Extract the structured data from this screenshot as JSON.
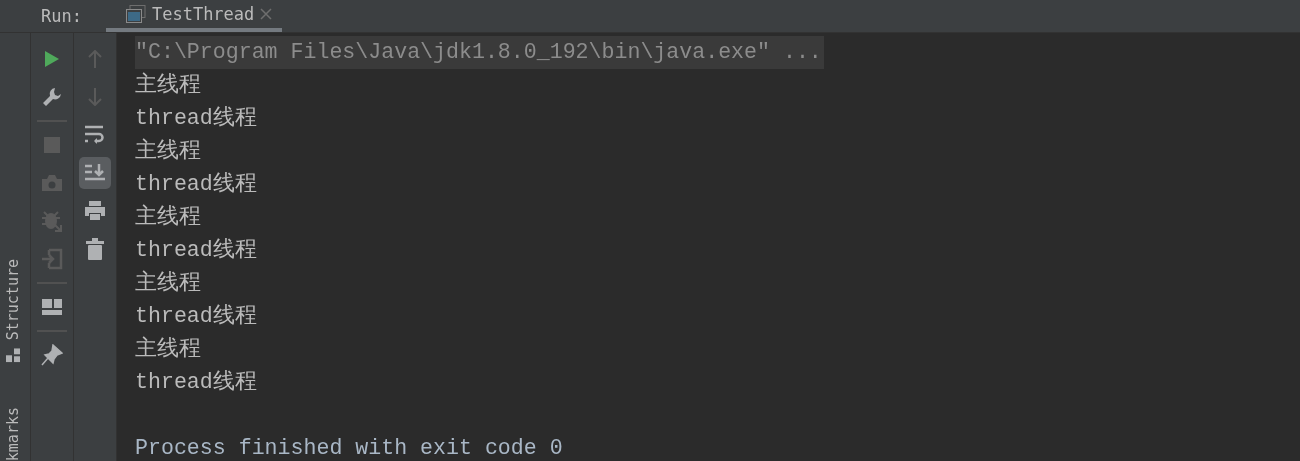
{
  "header": {
    "label": "Run:",
    "tabs": [
      {
        "title": "TestThread",
        "selected": true,
        "closable": true
      }
    ]
  },
  "side_stripe": [
    {
      "kind": "structure",
      "label": "Structure"
    },
    {
      "kind": "bookmarks",
      "label": "kmarks"
    }
  ],
  "run_toolbar": [
    {
      "kind": "run",
      "disabled": false
    },
    {
      "kind": "wrench",
      "disabled": false
    },
    {
      "kind": "separator"
    },
    {
      "kind": "stop",
      "disabled": true
    },
    {
      "kind": "camera",
      "disabled": true
    },
    {
      "kind": "debug",
      "disabled": true
    },
    {
      "kind": "exit",
      "disabled": true
    },
    {
      "kind": "separator"
    },
    {
      "kind": "layout",
      "disabled": false
    },
    {
      "kind": "separator"
    },
    {
      "kind": "pin",
      "disabled": false
    }
  ],
  "console_toolbar": [
    {
      "kind": "up",
      "disabled": true,
      "selected": false
    },
    {
      "kind": "down",
      "disabled": true,
      "selected": false
    },
    {
      "kind": "wrap",
      "disabled": false,
      "selected": false
    },
    {
      "kind": "scroll-end",
      "disabled": false,
      "selected": true
    },
    {
      "kind": "print",
      "disabled": false,
      "selected": false
    },
    {
      "kind": "trash",
      "disabled": false,
      "selected": false
    }
  ],
  "console": [
    {
      "kind": "system",
      "text": "\"C:\\Program Files\\Java\\jdk1.8.0_192\\bin\\java.exe\" ...",
      "highlighted": true
    },
    {
      "kind": "output",
      "text": "主线程"
    },
    {
      "kind": "output",
      "text": "thread线程"
    },
    {
      "kind": "output",
      "text": "主线程"
    },
    {
      "kind": "output",
      "text": "thread线程"
    },
    {
      "kind": "output",
      "text": "主线程"
    },
    {
      "kind": "output",
      "text": "thread线程"
    },
    {
      "kind": "output",
      "text": "主线程"
    },
    {
      "kind": "output",
      "text": "thread线程"
    },
    {
      "kind": "output",
      "text": "主线程"
    },
    {
      "kind": "output",
      "text": "thread线程"
    },
    {
      "kind": "blank"
    },
    {
      "kind": "system",
      "text": "Process finished with exit code 0",
      "highlighted": false
    }
  ]
}
